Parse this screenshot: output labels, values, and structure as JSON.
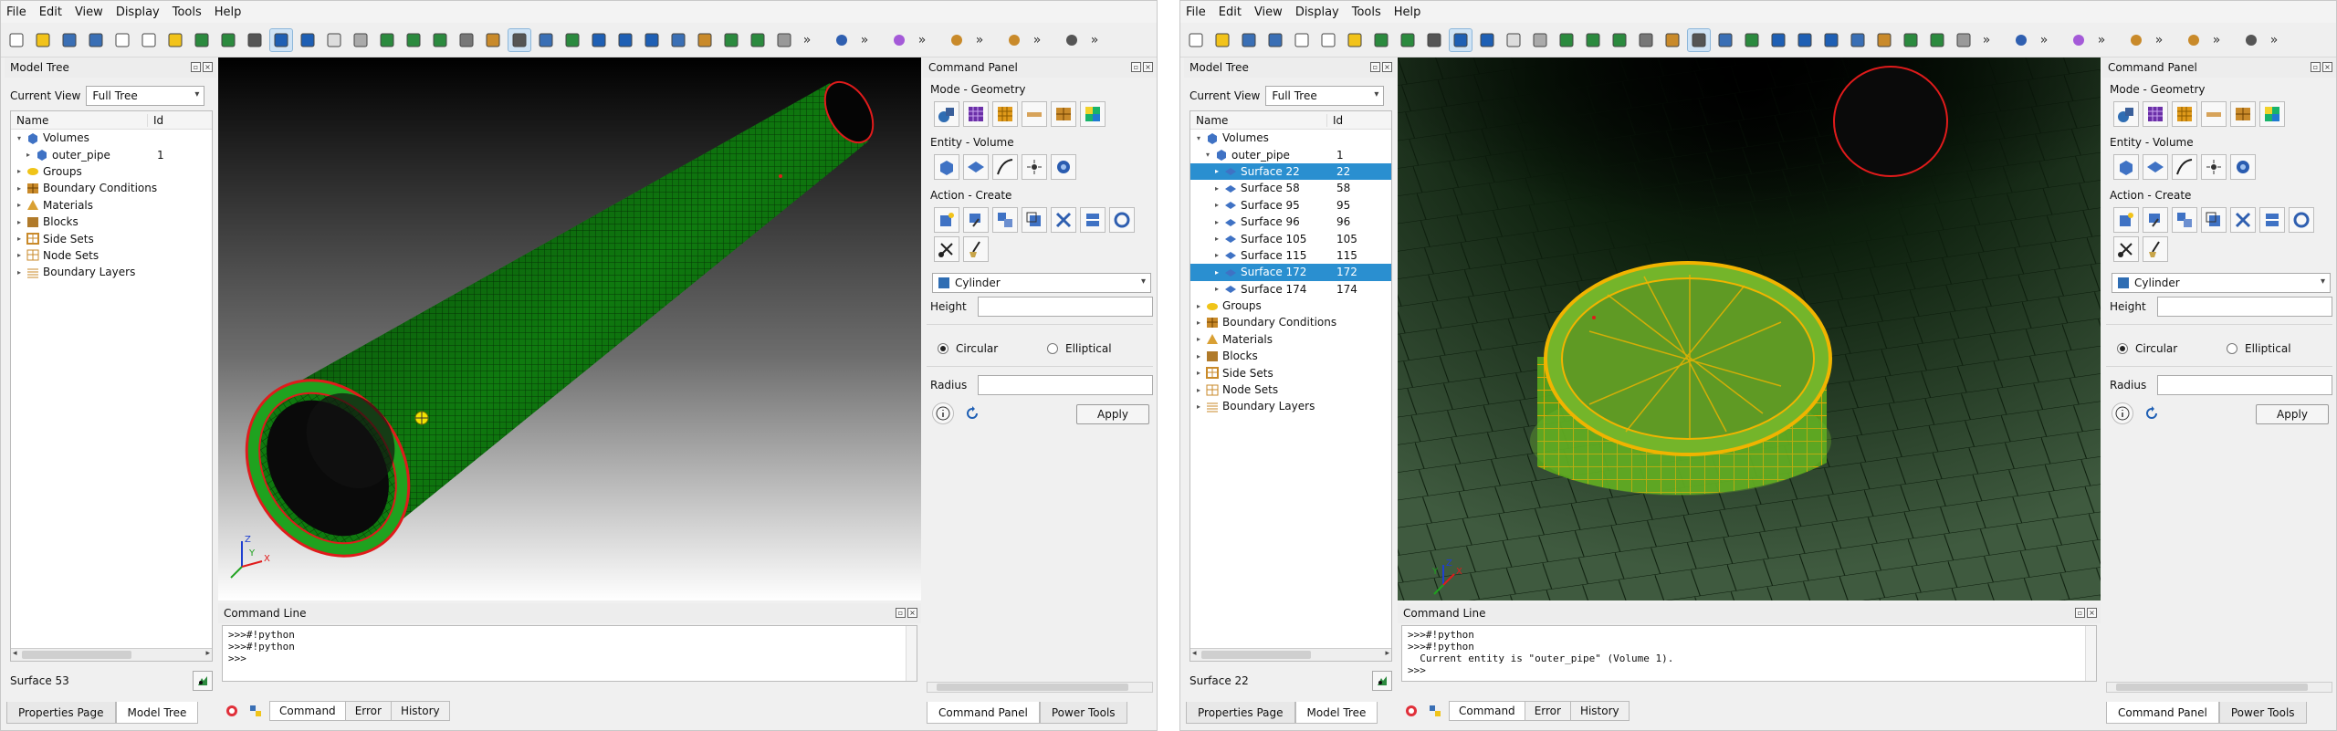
{
  "menus": [
    "File",
    "Edit",
    "View",
    "Display",
    "Tools",
    "Help"
  ],
  "toolbar": {
    "overflow": "»"
  },
  "model_tree": {
    "title": "Model Tree",
    "current_view_label": "Current View",
    "current_view_value": "Full Tree",
    "col_name": "Name",
    "col_id": "Id"
  },
  "command_panel": {
    "title": "Command Panel",
    "mode_label": "Mode - Geometry",
    "entity_label": "Entity - Volume",
    "action_label": "Action - Create",
    "shape_value": "Cylinder",
    "height_label": "Height",
    "circular_label": "Circular",
    "elliptical_label": "Elliptical",
    "radius_label": "Radius",
    "apply_label": "Apply"
  },
  "command_line": {
    "title": "Command Line"
  },
  "cmd_tabs": {
    "command": "Command",
    "error": "Error",
    "history": "History"
  },
  "bottom_tabs": {
    "properties": "Properties Page",
    "model_tree": "Model Tree",
    "command_panel": "Command Panel",
    "power_tools": "Power Tools"
  },
  "left": {
    "tree": [
      {
        "name": "Volumes",
        "icon": "volume-icon",
        "expanded": true
      },
      {
        "name": "outer_pipe",
        "id": "1",
        "icon": "volume-icon"
      },
      {
        "name": "Groups",
        "icon": "group-icon"
      },
      {
        "name": "Boundary Conditions",
        "icon": "boundary-icon"
      },
      {
        "name": "Materials",
        "icon": "material-icon"
      },
      {
        "name": "Blocks",
        "icon": "block-icon"
      },
      {
        "name": "Side Sets",
        "icon": "sideset-icon"
      },
      {
        "name": "Node Sets",
        "icon": "nodeset-icon"
      },
      {
        "name": "Boundary Layers",
        "icon": "boundary-layer-icon"
      }
    ],
    "status": "Surface 53",
    "cmd_lines": [
      ">>>#!python",
      ">>>#!python",
      ">>>"
    ]
  },
  "right": {
    "tree": [
      {
        "name": "Volumes",
        "icon": "volume-icon",
        "expanded": true
      },
      {
        "name": "outer_pipe",
        "id": "1",
        "icon": "volume-icon",
        "expanded": true
      },
      {
        "name": "Surface 22",
        "id": "22",
        "icon": "surface-icon",
        "selected": true
      },
      {
        "name": "Surface 58",
        "id": "58",
        "icon": "surface-icon"
      },
      {
        "name": "Surface 95",
        "id": "95",
        "icon": "surface-icon"
      },
      {
        "name": "Surface 96",
        "id": "96",
        "icon": "surface-icon"
      },
      {
        "name": "Surface 105",
        "id": "105",
        "icon": "surface-icon"
      },
      {
        "name": "Surface 115",
        "id": "115",
        "icon": "surface-icon"
      },
      {
        "name": "Surface 172",
        "id": "172",
        "icon": "surface-icon",
        "selected": true
      },
      {
        "name": "Surface 174",
        "id": "174",
        "icon": "surface-icon"
      },
      {
        "name": "Groups",
        "icon": "group-icon"
      },
      {
        "name": "Boundary Conditions",
        "icon": "boundary-icon"
      },
      {
        "name": "Materials",
        "icon": "material-icon"
      },
      {
        "name": "Blocks",
        "icon": "block-icon"
      },
      {
        "name": "Side Sets",
        "icon": "sideset-icon"
      },
      {
        "name": "Node Sets",
        "icon": "nodeset-icon"
      },
      {
        "name": "Boundary Layers",
        "icon": "boundary-layer-icon"
      }
    ],
    "status": "Surface 22",
    "cmd_lines": [
      ">>>#!python",
      ">>>#!python",
      "  Current entity is \"outer_pipe\" (Volume 1).",
      ">>>"
    ]
  },
  "axes": {
    "x": "X",
    "y": "Y",
    "z": "Z"
  },
  "colors": {
    "selection": "#2a8fd0",
    "mesh_green": "#1fa21f",
    "mesh_yellow": "#f0b400",
    "edge_red": "#e01b1b",
    "accent_blue": "#1e5fb4"
  }
}
